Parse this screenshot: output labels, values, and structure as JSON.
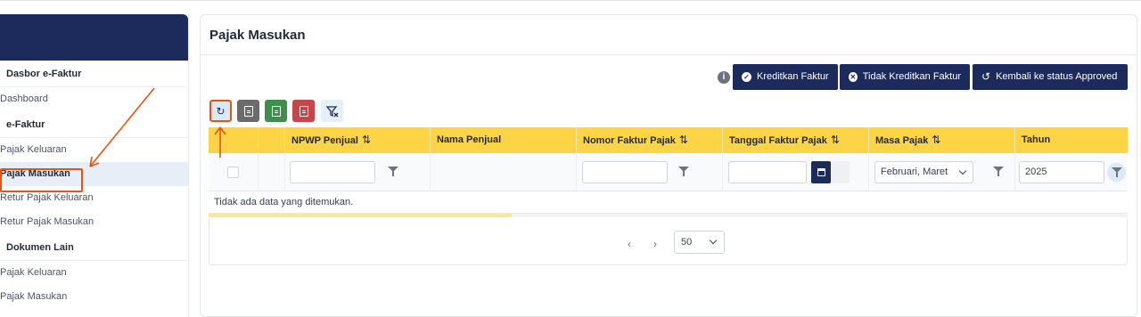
{
  "sidebar": {
    "sections": [
      {
        "label": "Dasbor e-Faktur",
        "items": [
          "Dashboard"
        ]
      },
      {
        "label": "e-Faktur",
        "items": [
          "Pajak Keluaran",
          "Pajak Masukan",
          "Retur Pajak Keluaran",
          "Retur Pajak Masukan"
        ]
      },
      {
        "label": "Dokumen Lain",
        "items": [
          "Pajak Keluaran",
          "Pajak Masukan"
        ]
      }
    ],
    "active_item": "Pajak Masukan"
  },
  "page": {
    "title": "Pajak Masukan"
  },
  "actions": {
    "info_icon": "i",
    "kreditkan_label": "Kreditkan Faktur",
    "tidak_kreditkan_label": "Tidak Kreditkan Faktur",
    "kembali_label": "Kembali ke status Approved"
  },
  "toolbar": {
    "icons": [
      "refresh-icon",
      "document-icon",
      "excel-icon",
      "pdf-icon",
      "clear-filter-icon"
    ]
  },
  "table": {
    "columns": [
      {
        "label": ""
      },
      {
        "label": ""
      },
      {
        "label": "NPWP Penjual",
        "sortable": true
      },
      {
        "label": "Nama Penjual",
        "sortable": false
      },
      {
        "label": "Nomor Faktur Pajak",
        "sortable": true
      },
      {
        "label": "Tanggal Faktur Pajak",
        "sortable": true
      },
      {
        "label": "Masa Pajak",
        "sortable": true
      },
      {
        "label": "Tahun",
        "sortable": false
      }
    ],
    "filters": {
      "npwp_value": "",
      "nomor_value": "",
      "tanggal_value": "",
      "masa_pajak_value": "Februari, Maret",
      "tahun_value": "2025"
    },
    "empty_message": "Tidak ada data yang ditemukan.",
    "loading_progress": 0.33
  },
  "pagination": {
    "prev_icon": "‹",
    "next_icon": "›",
    "page_size": "50"
  },
  "colors": {
    "navy": "#1d2a5c",
    "header_yellow": "#fdd446",
    "annotation_orange": "#e8540f"
  }
}
